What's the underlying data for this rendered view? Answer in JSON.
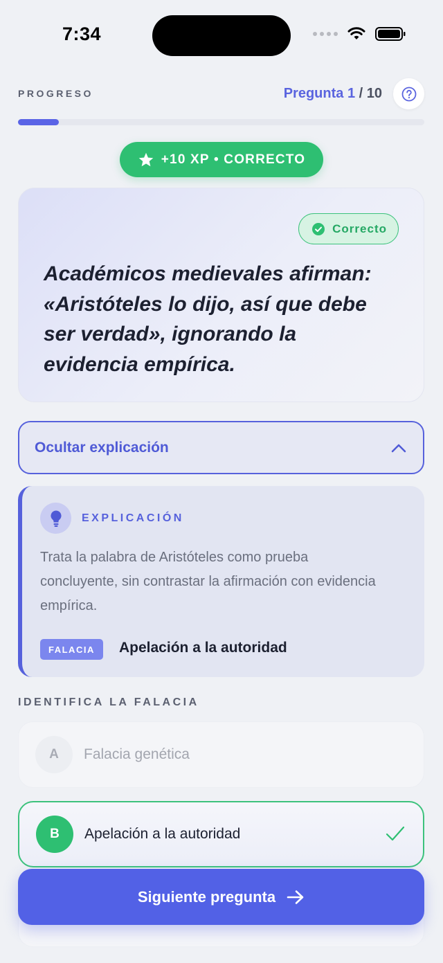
{
  "status_bar": {
    "time": "7:34"
  },
  "progress": {
    "label": "PROGRESO",
    "question_prefix": "Pregunta",
    "current": "1",
    "total": "/ 10",
    "fraction_complete": 0.1
  },
  "xp_badge": {
    "text": "+10 XP • CORRECTO"
  },
  "question": {
    "status_badge": "Correcto",
    "text": "Académicos medievales afirman: «Aristóteles lo dijo, así que debe ser verdad», ignorando la evidencia empírica."
  },
  "explanation_toggle": {
    "label": "Ocultar explicación"
  },
  "explanation": {
    "title": "EXPLICACIÓN",
    "body": "Trata la palabra de Aristóteles como prueba concluyente, sin contrastar la afirmación con evidencia empírica.",
    "tag": "FALACIA",
    "fallacy_name": "Apelación a la autoridad"
  },
  "options_section": {
    "label": "IDENTIFICA LA FALACIA",
    "options": [
      {
        "letter": "A",
        "text": "Falacia genética",
        "state": "dimmed"
      },
      {
        "letter": "B",
        "text": "Apelación a la autoridad",
        "state": "correct"
      }
    ]
  },
  "next_button": {
    "label": "Siguiente pregunta"
  },
  "colors": {
    "accent": "#5261e6",
    "success": "#2ebf72",
    "background": "#eff1f5"
  },
  "icons": [
    "star-icon",
    "check-circle-icon",
    "help-circle-icon",
    "chevron-up-icon",
    "lightbulb-icon",
    "checkmark-icon",
    "arrow-right-icon",
    "wifi-icon",
    "battery-icon"
  ]
}
